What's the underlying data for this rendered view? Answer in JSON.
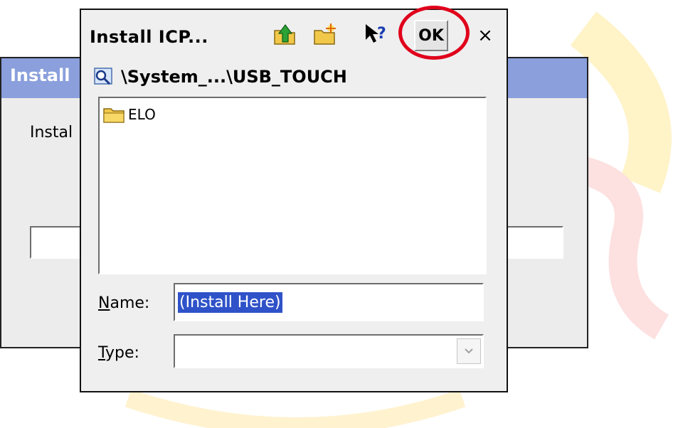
{
  "background_window": {
    "title": "Install",
    "label": "Instal"
  },
  "dialog": {
    "title": "Install ICP...",
    "ok_label": "OK",
    "close_label": "×",
    "path": "\\System_...\\USB_TOUCH",
    "list_items": [
      {
        "label": "ELO",
        "icon": "folder-icon"
      }
    ],
    "name_label_accel": "N",
    "name_label_rest": "ame:",
    "name_value": "(Install Here)",
    "type_label_accel": "T",
    "type_label_rest": "ype:",
    "type_value": ""
  },
  "colors": {
    "highlight": "#e0001b",
    "selection": "#2f52c8",
    "bg_titlebar": "#8a9fdc"
  }
}
